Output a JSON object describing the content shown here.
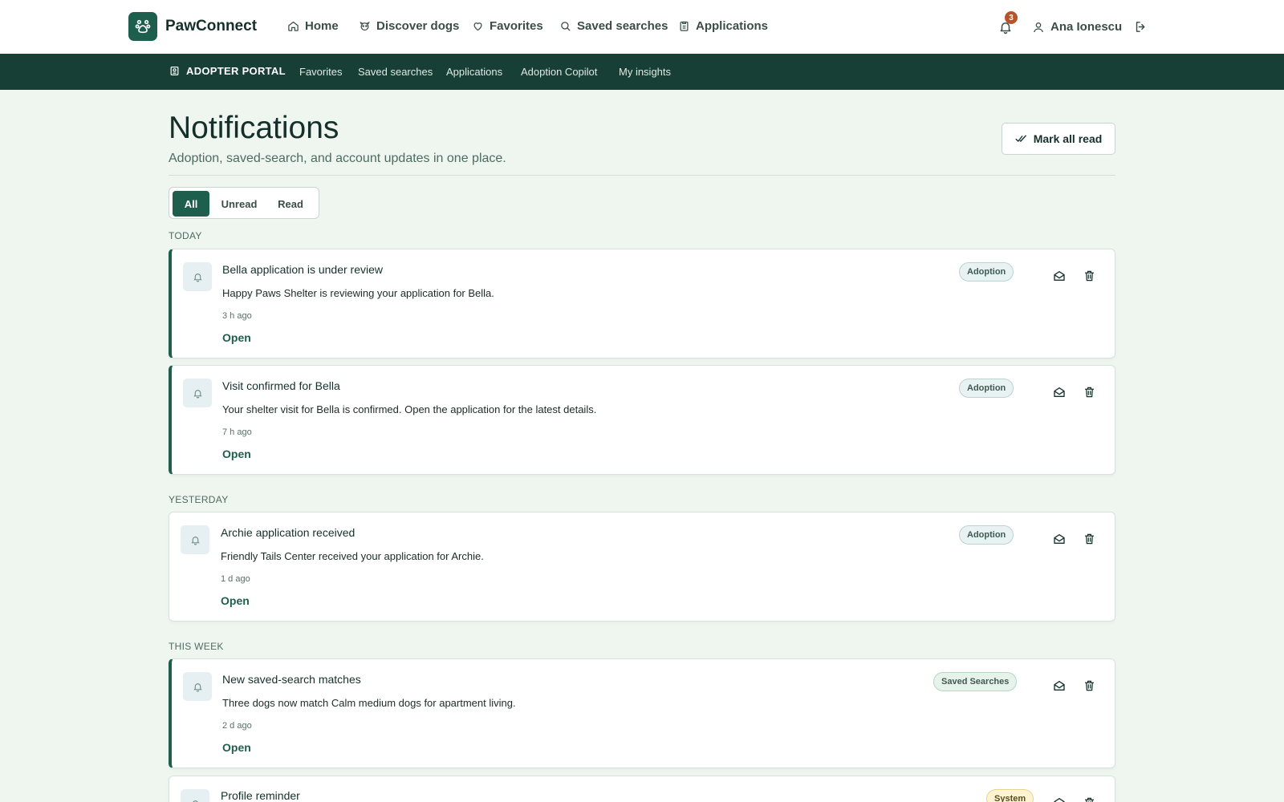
{
  "topnav": {
    "brand": "PawConnect",
    "links": [
      {
        "label": "Home",
        "icon": "home-icon"
      },
      {
        "label": "Discover dogs",
        "icon": "paw-icon"
      },
      {
        "label": "Favorites",
        "icon": "heart-icon"
      },
      {
        "label": "Saved searches",
        "icon": "search-icon"
      },
      {
        "label": "Applications",
        "icon": "clipboard-icon"
      }
    ],
    "notification_count": "3",
    "user_name": "Ana Ionescu"
  },
  "subnav": {
    "portal_label": "ADOPTER PORTAL",
    "links": [
      "Favorites",
      "Saved searches",
      "Applications",
      "Adoption Copilot",
      "My insights"
    ]
  },
  "header": {
    "title": "Notifications",
    "subtitle": "Adoption, saved-search, and account updates in one place.",
    "mark_all_read": "Mark all read"
  },
  "filters": {
    "tabs": [
      "All",
      "Unread",
      "Read"
    ],
    "active": "All"
  },
  "groups": [
    {
      "label": "TODAY",
      "items": [
        {
          "title": "Bella application is under review",
          "body": "Happy Paws Shelter is reviewing your application for Bella.",
          "time": "3 h ago",
          "open": "Open",
          "tag": "Adoption",
          "unread": true
        },
        {
          "title": "Visit confirmed for Bella",
          "body": "Your shelter visit for Bella is confirmed. Open the application for the latest details.",
          "time": "7 h ago",
          "open": "Open",
          "tag": "Adoption",
          "unread": true
        }
      ]
    },
    {
      "label": "YESTERDAY",
      "items": [
        {
          "title": "Archie application received",
          "body": "Friendly Tails Center received your application for Archie.",
          "time": "1 d ago",
          "open": "Open",
          "tag": "Adoption",
          "unread": false
        }
      ]
    },
    {
      "label": "THIS WEEK",
      "items": [
        {
          "title": "New saved-search matches",
          "body": "Three dogs now match Calm medium dogs for apartment living.",
          "time": "2 d ago",
          "open": "Open",
          "tag": "Saved Searches",
          "unread": true
        },
        {
          "title": "Profile reminder",
          "tag": "System",
          "unread": false
        }
      ]
    }
  ],
  "colors": {
    "brand": "#1e5e4c",
    "subnav": "#173f35",
    "page_bg": "#eff5ef",
    "badge": "#b5532a"
  }
}
